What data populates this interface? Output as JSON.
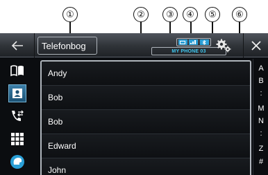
{
  "callouts": [
    "①",
    "②",
    "③",
    "④",
    "⑤",
    "⑥"
  ],
  "header": {
    "title": "Telefonbog",
    "phone_name": "MY PHONE 03",
    "back_icon": "back-icon",
    "settings_icon": "gears-icon",
    "close_icon": "close-icon"
  },
  "nav": [
    {
      "icon": "phonebook-book-icon",
      "active": false
    },
    {
      "icon": "contacts-card-icon",
      "active": true
    },
    {
      "icon": "call-history-icon",
      "active": false
    },
    {
      "icon": "keypad-icon",
      "active": false
    },
    {
      "icon": "voice-recognition-icon",
      "active": false
    }
  ],
  "contacts": [
    "Andy",
    "Bob",
    "Bob",
    "Edward",
    "John"
  ],
  "alphabet_index": [
    "A",
    "B",
    ":",
    "M",
    "N",
    ":",
    "Z",
    "#"
  ],
  "colors": {
    "accent": "#3fc8f0",
    "active_nav": "#2a6f99",
    "background": "#0b0d10"
  }
}
